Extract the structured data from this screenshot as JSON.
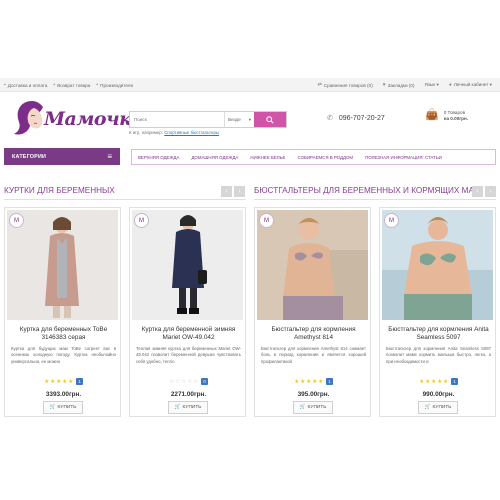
{
  "topbar": {
    "left": [
      {
        "icon": "truck-icon",
        "label": "Доставка и оплата"
      },
      {
        "icon": "return-icon",
        "label": "Возврат товара"
      },
      {
        "icon": "factory-icon",
        "label": "Производители"
      }
    ],
    "right": [
      {
        "icon": "compare-icon",
        "label": "Сравнение товаров (0)"
      },
      {
        "icon": "heart-icon",
        "label": "Закладки (0)"
      },
      {
        "icon": "",
        "label": "Язык ▾"
      },
      {
        "icon": "user-icon",
        "label": "Личный кабинет ▾"
      }
    ]
  },
  "logo": {
    "text": "Мамочка"
  },
  "search": {
    "placeholder": "Поиск",
    "category": "Везде",
    "hint_prefix": "К игр, например:",
    "hint_link": "Спортивные бюстгальтеры"
  },
  "phone": "096-707-20-27",
  "cart": {
    "line1": "0 Товаров",
    "line2": "на 0.00грн."
  },
  "categories_label": "КАТЕГОРИИ",
  "nav": [
    "ВЕРХНЯЯ ОДЕЖДА",
    "ДОМАШНЯЯ ОДЕЖДА",
    "НИЖНЕЕ БЕЛЬЕ",
    "СОБИРАЕМСЯ В РОДДОМ",
    "ПОЛЕЗНАЯ ИНФОРМАЦИЯ: СТАТЬИ"
  ],
  "sections": [
    {
      "title": "КУРТКИ ДЛЯ БЕРЕМЕННЫХ"
    },
    {
      "title": "БЮСТГАЛЬТЕРЫ ДЛЯ БЕРЕМЕННЫХ И КОРМЯЩИХ МАМ"
    }
  ],
  "buy_label": "КУПИТЬ",
  "products": [
    {
      "name": "Куртка для беременных ToBe 3146383 серая",
      "desc": "Куртка для будущих мам ToBe согреет вас в осеннюю холодную погоду. Куртка необычайно универсальна, ее можно",
      "rating": 5,
      "reviews": "1",
      "price": "3393.00грн.",
      "colors": {
        "bg": "#e9e6e3",
        "garment": "#c79c8e",
        "accent": "#b0b4b9"
      }
    },
    {
      "name": "Куртка для беременной зимняя Mariet OW-49.042",
      "desc": "Теплая зимняя куртка для беременных Mariet OW-49.042 позволит беременной девушке чувствовать себя удобно, тепло",
      "rating": 0,
      "reviews": "0",
      "price": "2271.00грн.",
      "colors": {
        "bg": "#ededed",
        "garment": "#2b3152",
        "accent": "#1c1c1c"
      }
    },
    {
      "name": "Бюстгальтер для кормления Amethyst 814",
      "desc": "Бюстгальтер для кормления Amethyst 814 снимает боль в период кормления и является хорошей профилактикой",
      "rating": 5,
      "reviews": "1",
      "price": "395.00грн.",
      "colors": {
        "bg": "#d9c7b5",
        "garment": "#a48fa0",
        "accent": "#e2b496"
      }
    },
    {
      "name": "Бюстгальтер для кормления Anita Seamless 5097",
      "desc": "Бюстгальтер для кормления Anita Seamless 5097 позволит маме кормить малыша быстро, легко, а при необходимости и",
      "rating": 5,
      "reviews": "1",
      "price": "990.00грн.",
      "colors": {
        "bg": "#cfe0e8",
        "garment": "#7fa493",
        "accent": "#e6b899"
      }
    }
  ]
}
